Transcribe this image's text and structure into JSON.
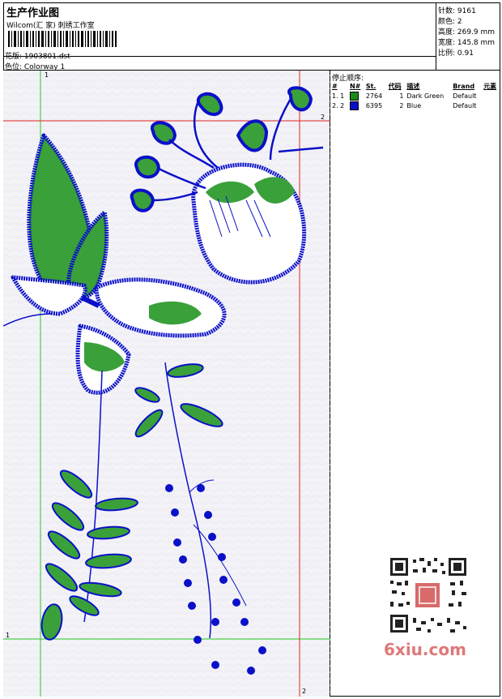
{
  "header": {
    "title": "生产作业图",
    "company": "Wilcom(汇 家) 刺绣工作室",
    "design_label": "花版: 1903801.dst",
    "colorway_label": "色位: Colorway 1"
  },
  "stats": {
    "stitches": "针数: 9161",
    "colors": "颜色: 2",
    "height": "高度: 269.9 mm",
    "width": "宽度: 145.8 mm",
    "scale": "比例: 0.91"
  },
  "stop_sequence": {
    "title": "停止顺序:",
    "columns": [
      "#",
      "N#",
      "St.",
      "代码",
      "描述",
      "Brand",
      "元素"
    ],
    "rows": [
      {
        "num": "1. 1",
        "color": "#1a8a1a",
        "stitches": "2764",
        "code": "1",
        "desc": "Dark Green",
        "brand": "Default"
      },
      {
        "num": "2. 2",
        "color": "#0a10c8",
        "stitches": "6395",
        "code": "2",
        "desc": "Blue",
        "brand": "Default"
      }
    ]
  },
  "guides": {
    "green_top": "1",
    "green_left": "1",
    "red_right": "2",
    "red_bottom": "2"
  },
  "watermark": "6xiu.com",
  "colors": {
    "green_thread": "#1a8a1a",
    "blue_thread": "#0a10c8",
    "guide_green": "#22cc22",
    "guide_red": "#dd2222"
  }
}
